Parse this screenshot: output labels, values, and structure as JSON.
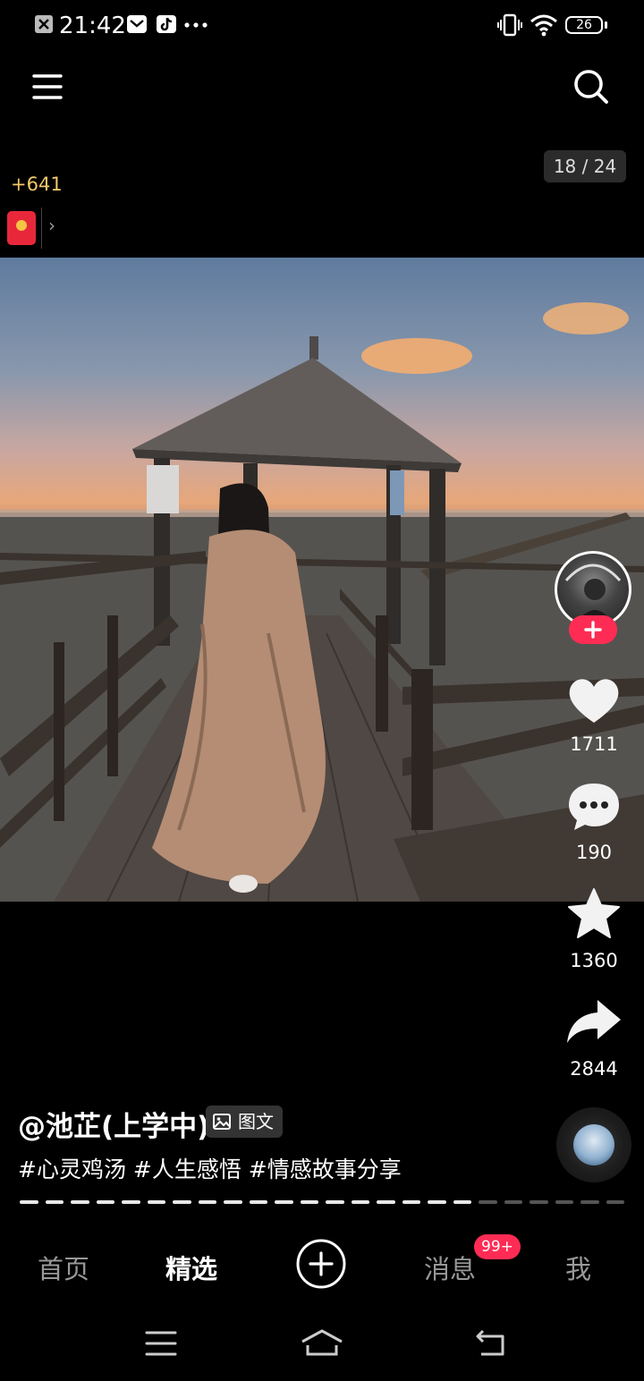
{
  "status_bar": {
    "time": "21:42",
    "battery": "26"
  },
  "post": {
    "page_counter": "18 / 24",
    "reward_text": "+641",
    "author": "@池芷(上学中)",
    "post_type": "图文",
    "hashtags": "#心灵鸡汤 #人生感悟 #情感故事分享",
    "progress_current": 18,
    "progress_total": 24
  },
  "actions": {
    "likes": "1711",
    "comments": "190",
    "favorites": "1360",
    "shares": "2844"
  },
  "nav": {
    "home": "首页",
    "featured": "精选",
    "messages": "消息",
    "messages_badge": "99+",
    "me": "我"
  },
  "colors": {
    "accent": "#fe2c55",
    "reward": "#f3c86a"
  }
}
